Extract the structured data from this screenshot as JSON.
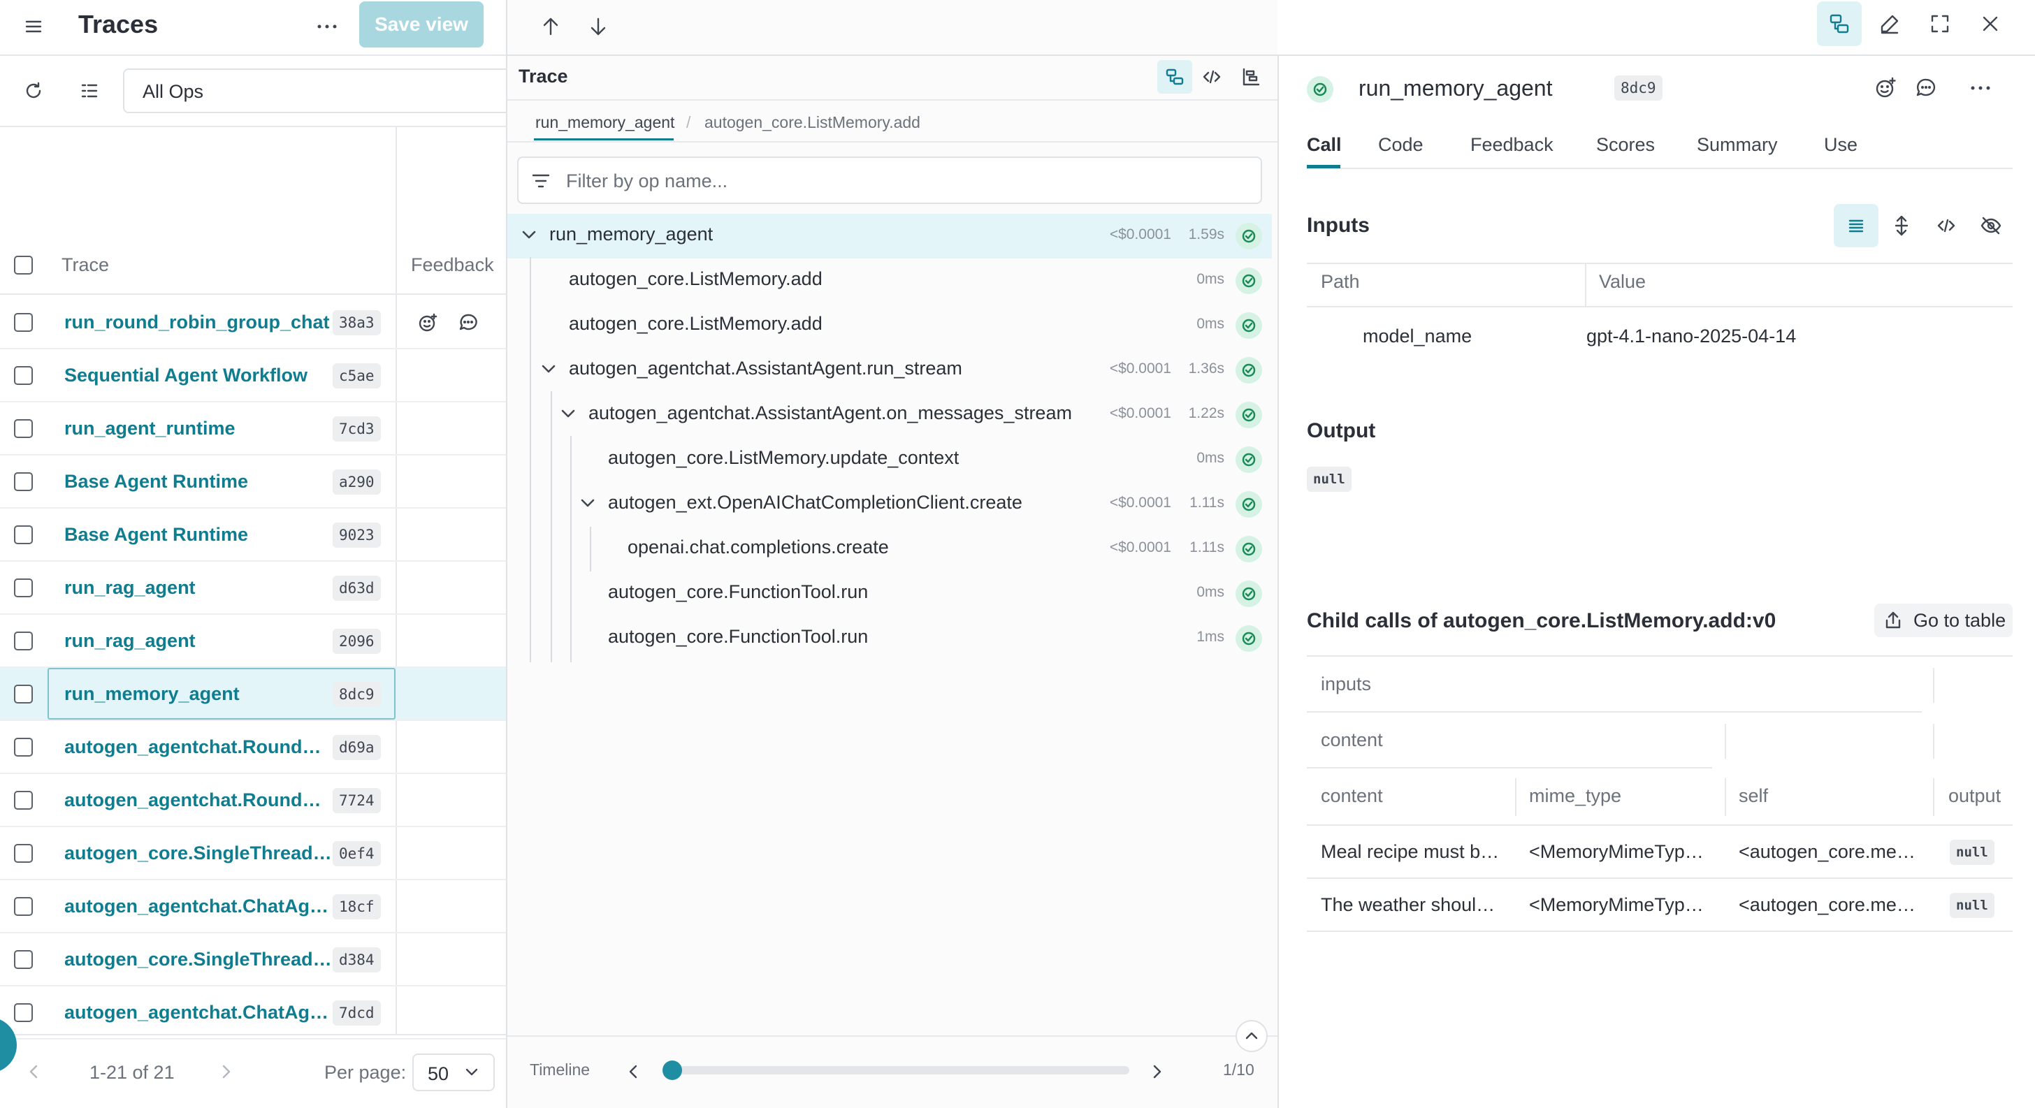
{
  "left_panel": {
    "title": "Traces",
    "save_view": "Save view",
    "filter_value": "All Ops",
    "col_trace": "Trace",
    "col_feedback": "Feedback",
    "rows": [
      {
        "name": "run_round_robin_group_chat",
        "id": "38a3"
      },
      {
        "name": "Sequential Agent Workflow",
        "id": "c5ae"
      },
      {
        "name": "run_agent_runtime",
        "id": "7cd3"
      },
      {
        "name": "Base Agent Runtime",
        "id": "a290"
      },
      {
        "name": "Base Agent Runtime",
        "id": "9023"
      },
      {
        "name": "run_rag_agent",
        "id": "d63d"
      },
      {
        "name": "run_rag_agent",
        "id": "2096"
      },
      {
        "name": "run_memory_agent",
        "id": "8dc9"
      },
      {
        "name": "autogen_agentchat.Round…",
        "id": "d69a"
      },
      {
        "name": "autogen_agentchat.Round…",
        "id": "7724"
      },
      {
        "name": "autogen_core.SingleThread…",
        "id": "0ef4"
      },
      {
        "name": "autogen_agentchat.ChatAg…",
        "id": "18cf"
      },
      {
        "name": "autogen_core.SingleThread…",
        "id": "d384"
      },
      {
        "name": "autogen_agentchat.ChatAg…",
        "id": "7dcd"
      }
    ],
    "pagination": "1-21 of 21",
    "per_page_label": "Per page:",
    "per_page_value": "50"
  },
  "middle_panel": {
    "title": "Trace",
    "breadcrumb": [
      "run_memory_agent",
      "autogen_core.ListMemory.add"
    ],
    "filter_placeholder": "Filter by op name...",
    "tree": [
      {
        "name": "run_memory_agent",
        "cost": "<$0.0001",
        "dur": "1.59s"
      },
      {
        "name": "autogen_core.ListMemory.add",
        "cost": "",
        "dur": "0ms"
      },
      {
        "name": "autogen_core.ListMemory.add",
        "cost": "",
        "dur": "0ms"
      },
      {
        "name": "autogen_agentchat.AssistantAgent.run_stream",
        "cost": "<$0.0001",
        "dur": "1.36s"
      },
      {
        "name": "autogen_agentchat.AssistantAgent.on_messages_stream",
        "cost": "<$0.0001",
        "dur": "1.22s"
      },
      {
        "name": "autogen_core.ListMemory.update_context",
        "cost": "",
        "dur": "0ms"
      },
      {
        "name": "autogen_ext.OpenAIChatCompletionClient.create",
        "cost": "<$0.0001",
        "dur": "1.11s"
      },
      {
        "name": "openai.chat.completions.create",
        "cost": "<$0.0001",
        "dur": "1.11s"
      },
      {
        "name": "autogen_core.FunctionTool.run",
        "cost": "",
        "dur": "0ms"
      },
      {
        "name": "autogen_core.FunctionTool.run",
        "cost": "",
        "dur": "1ms"
      }
    ],
    "timeline_label": "Timeline",
    "timeline_page": "1/10"
  },
  "right_panel": {
    "call_name": "run_memory_agent",
    "call_id": "8dc9",
    "tabs": [
      "Call",
      "Code",
      "Feedback",
      "Scores",
      "Summary",
      "Use"
    ],
    "inputs_title": "Inputs",
    "col_path": "Path",
    "col_value": "Value",
    "input_key": "model_name",
    "input_value": "gpt-4.1-nano-2025-04-14",
    "output_title": "Output",
    "output_value": "null",
    "child_title": "Child calls of autogen_core.ListMemory.add:v0",
    "go_to_table": "Go to table",
    "group_inputs": "inputs",
    "group_content": "content",
    "cols": [
      "content",
      "mime_type",
      "self",
      "output"
    ],
    "child_rows": [
      {
        "content": "Meal recipe must b…",
        "mime_type": "<MemoryMimeTyp…",
        "self": "<autogen_core.me…",
        "output": "null"
      },
      {
        "content": "The weather shoul…",
        "mime_type": "<MemoryMimeTyp…",
        "self": "<autogen_core.me…",
        "output": "null"
      }
    ]
  },
  "colors": {
    "accent": "#0f7d8f",
    "selected_bg": "#e3f5f8",
    "success_bg": "#d5f2e4",
    "success": "#1b8a55"
  }
}
